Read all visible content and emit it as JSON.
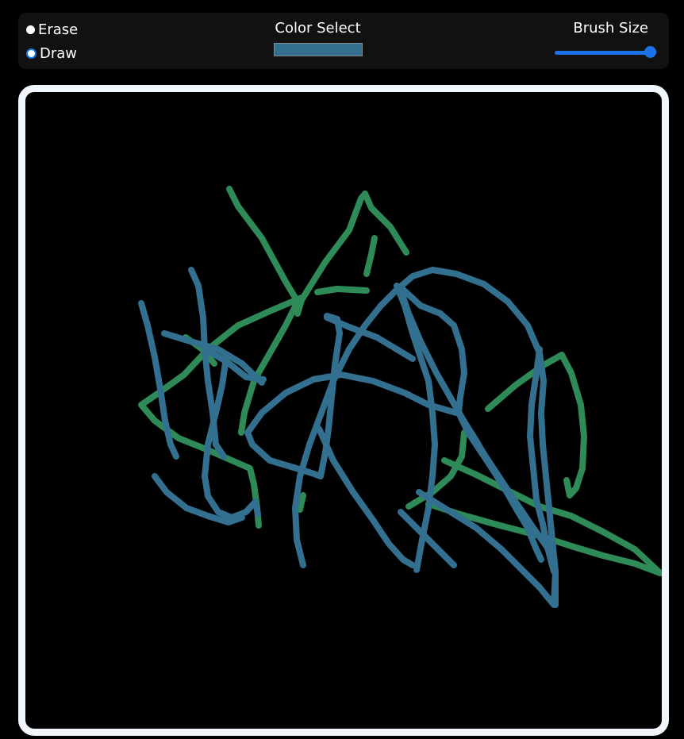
{
  "toolbar": {
    "modes": {
      "erase_label": "Erase",
      "draw_label": "Draw",
      "selected": "Draw"
    },
    "color_select": {
      "label": "Color Select",
      "value": "#336f8f"
    },
    "brush_size": {
      "label": "Brush Size",
      "value_fraction": 1.0
    }
  },
  "colors": {
    "accent": "#1a73e8",
    "canvas_background": "#000000",
    "canvas_border": "#f0f6fc",
    "toolbar_background": "#111111",
    "stroke_green": "#2e8b57",
    "stroke_blue": "#336f8f"
  }
}
